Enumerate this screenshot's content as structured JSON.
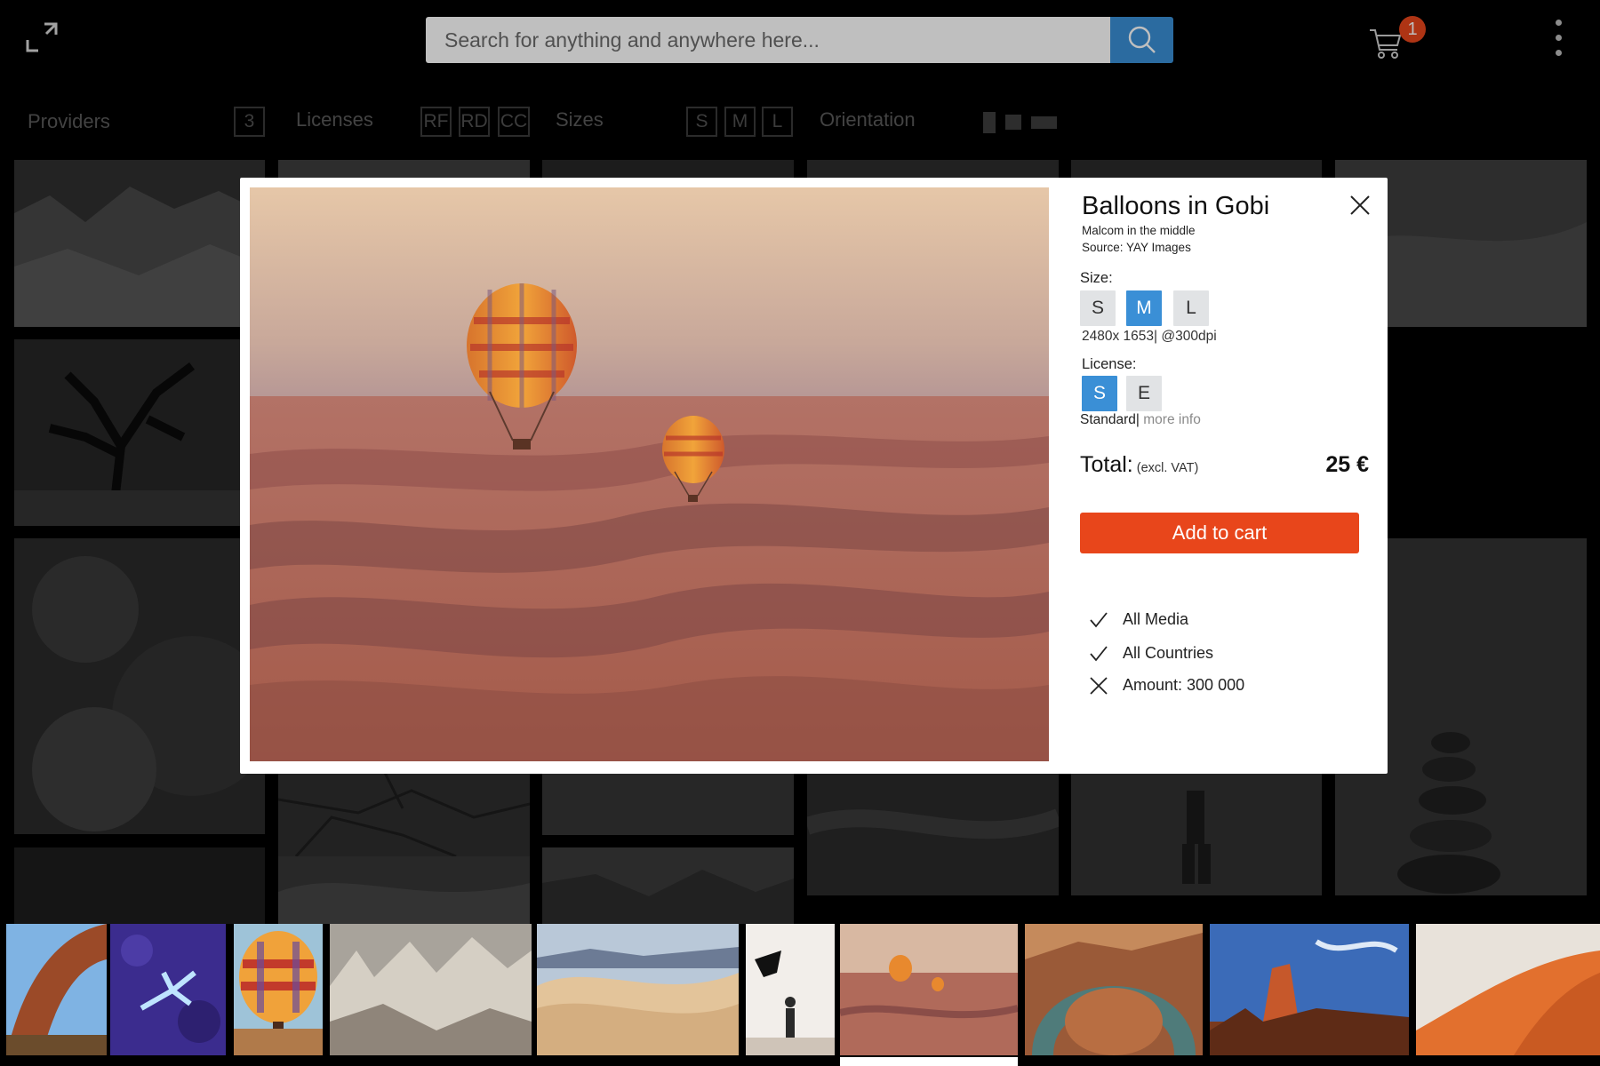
{
  "search": {
    "placeholder": "Search for anything and anywhere here..."
  },
  "cart": {
    "count": "1"
  },
  "filters": {
    "providers_label": "Providers",
    "providers_count": "3",
    "licenses_label": "Licenses",
    "licenses": [
      "RF",
      "RD",
      "CC"
    ],
    "sizes_label": "Sizes",
    "sizes": [
      "S",
      "M",
      "L"
    ],
    "orientation_label": "Orientation"
  },
  "modal": {
    "title": "Balloons in Gobi",
    "author": "Malcom in the middle",
    "source": "Source: YAY Images",
    "size_label": "Size:",
    "sizes": [
      "S",
      "M",
      "L"
    ],
    "selected_size": "M",
    "size_spec": "2480x 1653| @300dpi",
    "license_label": "License:",
    "licenses": [
      "S",
      "E"
    ],
    "selected_license": "S",
    "license_name": "Standard|",
    "license_more": "more info",
    "total_label": "Total:",
    "total_vat": "(excl. VAT)",
    "price": "25 €",
    "add_to_cart": "Add to cart",
    "features": [
      {
        "status": "check",
        "text": "All Media"
      },
      {
        "status": "check",
        "text": "All Countries"
      },
      {
        "status": "cross",
        "text": "Amount: 300 000"
      }
    ]
  },
  "icons": {
    "expand": "expand-icon",
    "search": "search-icon",
    "cart": "cart-icon",
    "menu": "kebab-menu-icon",
    "close": "close-icon",
    "check": "check-icon",
    "cross": "cross-icon"
  },
  "colors": {
    "accent_blue": "#3a8fd6",
    "accent_orange": "#e8461b",
    "option_bg": "#e1e3e5"
  }
}
